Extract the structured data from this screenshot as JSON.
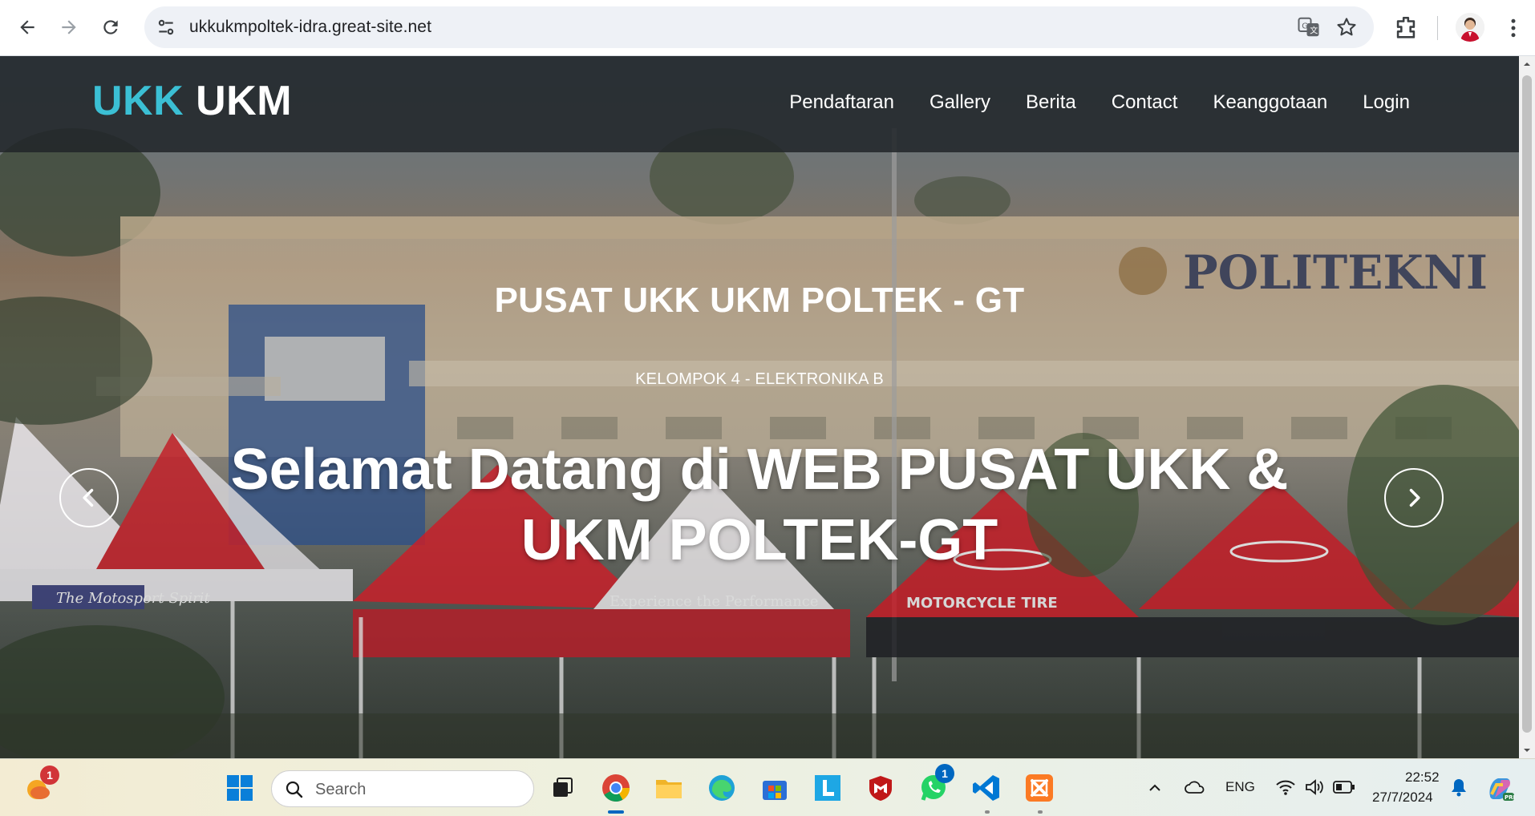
{
  "browser": {
    "url": "ukkukmpoltek-idra.great-site.net",
    "icons": [
      "back-icon",
      "forward-icon",
      "reload-icon",
      "site-info-icon",
      "translate-icon",
      "bookmark-star-icon",
      "extensions-icon",
      "profile-avatar",
      "more-menu-icon"
    ]
  },
  "site": {
    "brand_part1": "UKK",
    "brand_part2": "UKM",
    "brand_color": "#3bbfd4",
    "nav": [
      "Pendaftaran",
      "Gallery",
      "Berita",
      "Contact",
      "Keanggotaan",
      "Login"
    ],
    "hero": {
      "title": "PUSAT UKK UKM POLTEK - GT",
      "subtitle": "KELOMPOK 4 - ELEKTRONIKA B",
      "headline": "Selamat Datang di WEB PUSAT UKK & UKM POLTEK-GT"
    }
  },
  "taskbar": {
    "search_placeholder": "Search",
    "weather_badge": "1",
    "whatsapp_badge": "1",
    "language": "ENG",
    "time": "22:52",
    "date": "27/7/2024",
    "apps": [
      "start-icon",
      "task-view-icon",
      "chrome-icon",
      "file-explorer-icon",
      "edge-icon",
      "microsoft-store-icon",
      "l-app-icon",
      "mcafee-icon",
      "whatsapp-icon",
      "vscode-icon",
      "xampp-icon"
    ]
  }
}
